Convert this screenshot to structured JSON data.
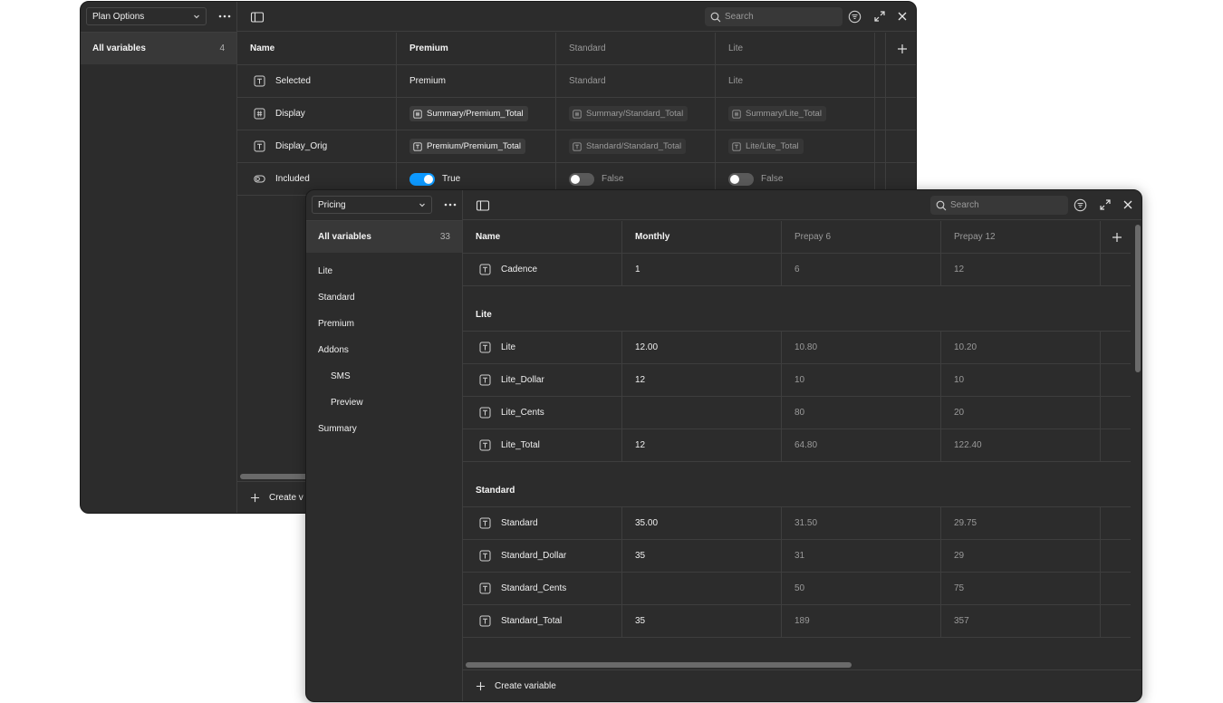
{
  "plan_options": {
    "collection": "Plan Options",
    "all_variables_label": "All variables",
    "all_variables_count": "4",
    "search_placeholder": "Search",
    "columns": [
      "Name",
      "Premium",
      "Standard",
      "Lite"
    ],
    "rows": [
      {
        "name": "Selected",
        "icon": "text-icon",
        "premium": "Premium",
        "standard": "Standard",
        "lite": "Lite"
      },
      {
        "name": "Display",
        "icon": "number-icon",
        "premium": "Summary/Premium_Total",
        "standard": "Summary/Standard_Total",
        "lite": "Summary/Lite_Total"
      },
      {
        "name": "Display_Orig",
        "icon": "text-icon",
        "premium": "Premium/Premium_Total",
        "standard": "Standard/Standard_Total",
        "lite": "Lite/Lite_Total"
      },
      {
        "name": "Included",
        "icon": "boolean-icon",
        "premium": "True",
        "standard": "False",
        "lite": "False"
      }
    ],
    "create_label": "Create v"
  },
  "pricing": {
    "collection": "Pricing",
    "all_variables_label": "All variables",
    "all_variables_count": "33",
    "groups": [
      "Lite",
      "Standard",
      "Premium",
      "Addons",
      "SMS",
      "Preview",
      "Summary"
    ],
    "search_placeholder": "Search",
    "columns": [
      "Name",
      "Monthly",
      "Prepay 6",
      "Prepay 12"
    ],
    "top_rows": [
      {
        "name": "Cadence",
        "monthly": "1",
        "prepay6": "6",
        "prepay12": "12"
      }
    ],
    "sections": [
      {
        "title": "Lite",
        "rows": [
          {
            "name": "Lite",
            "monthly": "12.00",
            "prepay6": "10.80",
            "prepay12": "10.20"
          },
          {
            "name": "Lite_Dollar",
            "monthly": "12",
            "prepay6": "10",
            "prepay12": "10"
          },
          {
            "name": "Lite_Cents",
            "monthly": "",
            "prepay6": "80",
            "prepay12": "20"
          },
          {
            "name": "Lite_Total",
            "monthly": "12",
            "prepay6": "64.80",
            "prepay12": "122.40"
          }
        ]
      },
      {
        "title": "Standard",
        "rows": [
          {
            "name": "Standard",
            "monthly": "35.00",
            "prepay6": "31.50",
            "prepay12": "29.75"
          },
          {
            "name": "Standard_Dollar",
            "monthly": "35",
            "prepay6": "31",
            "prepay12": "29"
          },
          {
            "name": "Standard_Cents",
            "monthly": "",
            "prepay6": "50",
            "prepay12": "75"
          },
          {
            "name": "Standard_Total",
            "monthly": "35",
            "prepay6": "189",
            "prepay12": "357"
          }
        ]
      }
    ],
    "create_label": "Create variable"
  }
}
